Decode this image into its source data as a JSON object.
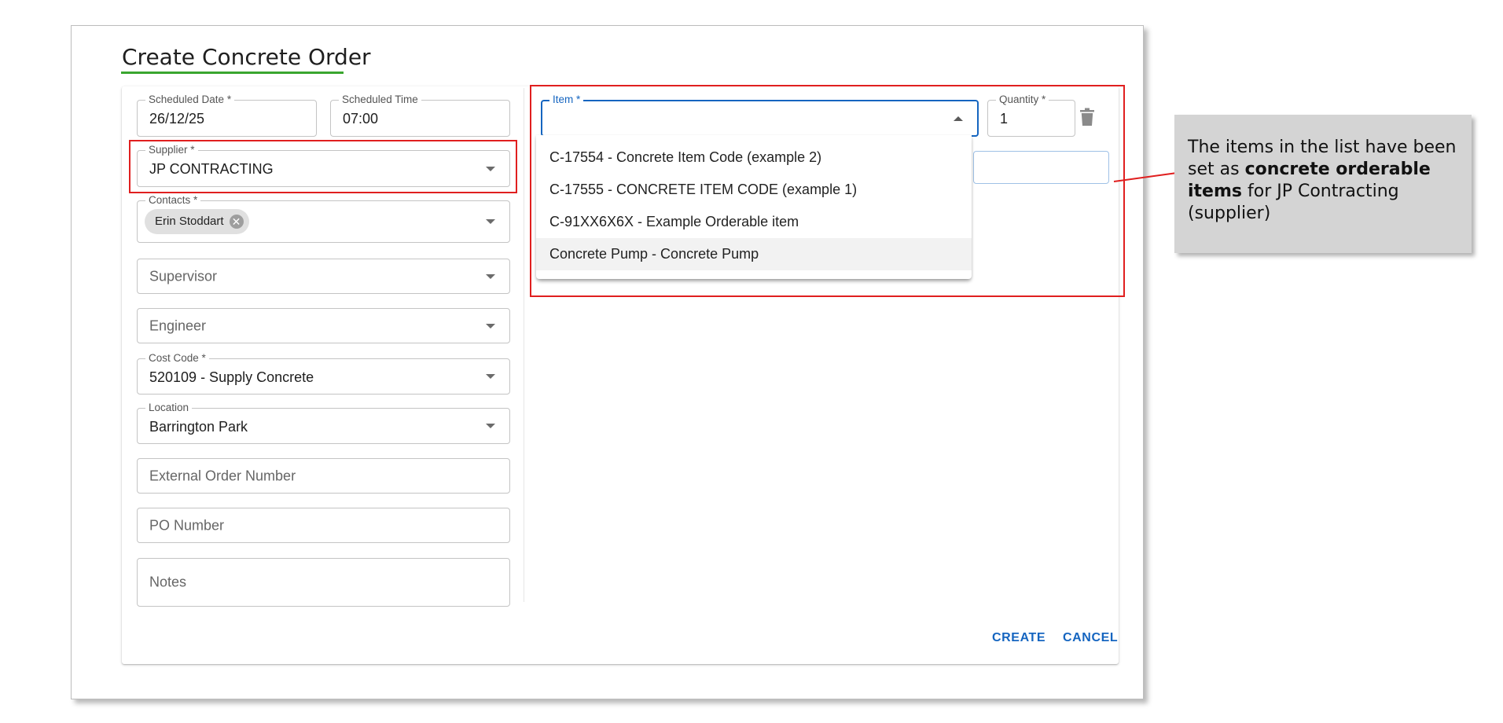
{
  "dialog": {
    "title": "Create Concrete Order",
    "accent_color": "#3aa62f",
    "highlight_color": "#e01f1f"
  },
  "form": {
    "scheduled_date": {
      "label": "Scheduled Date *",
      "value": "26/12/25"
    },
    "scheduled_time": {
      "label": "Scheduled Time",
      "value": "07:00"
    },
    "supplier": {
      "label": "Supplier *",
      "value": "JP CONTRACTING"
    },
    "contacts": {
      "label": "Contacts *",
      "chip": "Erin Stoddart"
    },
    "supervisor": {
      "placeholder": "Supervisor"
    },
    "engineer": {
      "placeholder": "Engineer"
    },
    "cost_code": {
      "label": "Cost Code *",
      "value": "520109 - Supply Concrete"
    },
    "location": {
      "label": "Location",
      "value": "Barrington Park"
    },
    "external_order_number": {
      "placeholder": "External Order Number"
    },
    "po_number": {
      "placeholder": "PO Number"
    },
    "notes": {
      "placeholder": "Notes"
    }
  },
  "items": {
    "item": {
      "label": "Item *",
      "value": ""
    },
    "quantity": {
      "label": "Quantity *",
      "value": "1"
    },
    "dropdown_options": [
      "C-17554 - Concrete Item Code (example 2)",
      "C-17555 - CONCRETE ITEM CODE (example 1)",
      "C-91XX6X6X - Example Orderable item",
      "Concrete Pump - Concrete Pump"
    ],
    "delete_icon": "trash-icon"
  },
  "actions": {
    "create_label": "CREATE",
    "cancel_label": "CANCEL",
    "button_color": "#1565c0"
  },
  "callout": {
    "text_before": "The items in the list have been set as ",
    "text_bold": "concrete orderable items",
    "text_after": " for JP Contracting (supplier)"
  }
}
